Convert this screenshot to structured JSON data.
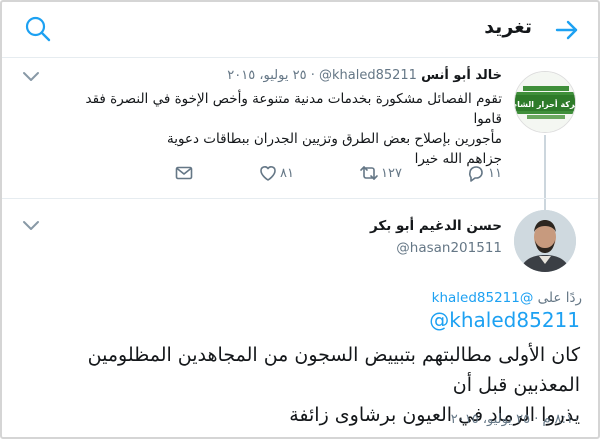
{
  "header": {
    "title": "تغريد"
  },
  "tweet_1": {
    "author_name": "خالد أبو أنس",
    "handle": "@khaled85211",
    "separator": "·",
    "date": "٢٥ يوليو، ٢٠١٥",
    "body_lines": [
      "تقوم الفصائل مشكورة بخدمات مدنية متنوعة وأخص الإخوة في النصرة فقد قاموا",
      "مأجورين بإصلاح بعض الطرق وتزيين الجدران ببطاقات دعوية",
      "جزاهم الله خيرا"
    ],
    "avatar_logo_text": "حركة أحرار الشام",
    "replies_count": "١١",
    "retweets_count": "١٢٧",
    "likes_count": "٨١"
  },
  "tweet_2": {
    "author_name": "حسن الدغيم أبو بكر",
    "handle": "@hasan201511",
    "reply_prefix": "ردًا على",
    "reply_to": "@khaled85211",
    "mention": "@khaled85211",
    "body_lines": [
      "كان الأولى مطالبتهم بتبييض السجون من المجاهدين المظلومين المعذبين قبل أن",
      "يذروا الرماد في العيون برشاوى زائفة"
    ],
    "timestamp": "٨:١٠ م · ٢٥ يوليو، ٢٠١٥"
  },
  "colors": {
    "accent": "#1da1f2",
    "muted": "#657786",
    "divider": "#e6ecf0",
    "text": "#14171a"
  },
  "icons": [
    "back-arrow-icon",
    "search-icon",
    "chevron-down-icon",
    "reply-icon",
    "retweet-icon",
    "like-icon",
    "message-icon"
  ]
}
